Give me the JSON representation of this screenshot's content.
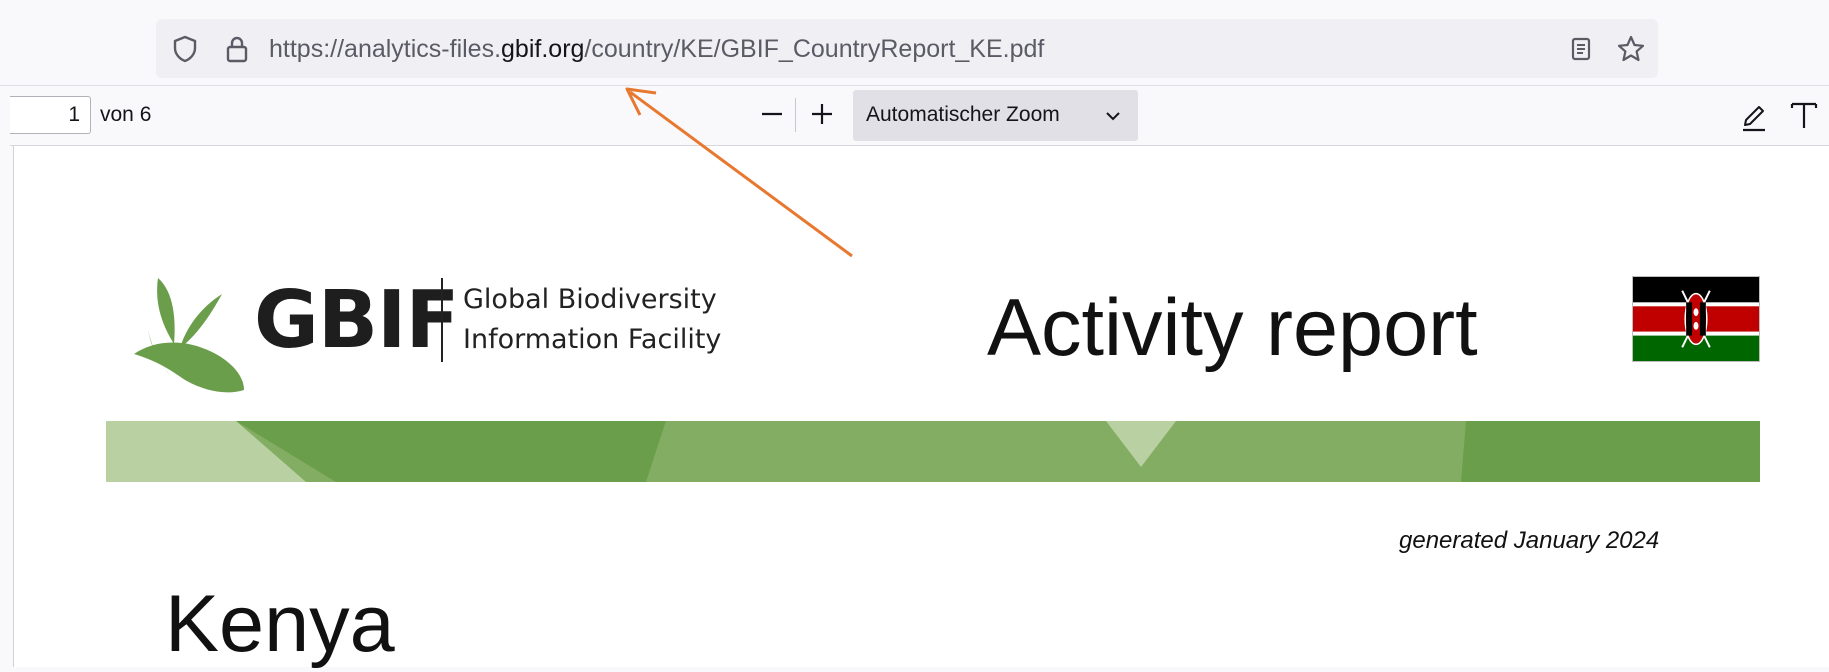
{
  "browser": {
    "url_prefix": "https://analytics-files.",
    "url_domain": "gbif.org",
    "url_path": "/country/KE/GBIF_CountryReport_KE.pdf",
    "icons": [
      "shield-icon",
      "lock-icon",
      "reader-view-icon",
      "bookmark-star-icon"
    ]
  },
  "pdf_toolbar": {
    "page_number": "1",
    "page_count": "von 6",
    "zoom_label": "Automatischer Zoom",
    "icons": [
      "zoom-out-icon",
      "zoom-in-icon",
      "chevron-down-icon",
      "highlight-icon",
      "text-icon"
    ]
  },
  "document": {
    "wordmark": "GBIF",
    "tagline_line1": "Global Biodiversity",
    "tagline_line2": "Information Facility",
    "title": "Activity report",
    "generated": "generated January 2024",
    "country": "Kenya"
  },
  "colors": {
    "gbif_green_dark": "#6b9e4a",
    "gbif_green_mid": "#82ad62",
    "gbif_green_light": "#b9d1a2",
    "annotation_arrow": "#e8782f",
    "flag_black": "#000000",
    "flag_red": "#c00000",
    "flag_green": "#006600"
  }
}
